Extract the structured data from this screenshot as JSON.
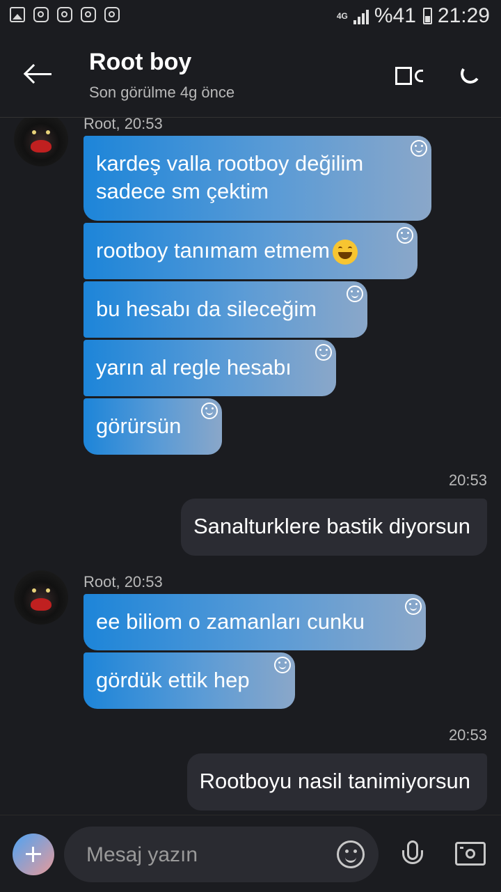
{
  "status_bar": {
    "battery": "%41",
    "time": "21:29",
    "network": "4G"
  },
  "header": {
    "title": "Root boy",
    "subtitle": "Son görülme 4g önce"
  },
  "messages": {
    "group1": {
      "sender": "Root, 20:53",
      "bubbles": [
        "kardeş valla rootboy değilim sadece sm  çektim",
        "rootboy tanımam etmem",
        "bu hesabı da sileceğim",
        "yarın al regle hesabı",
        "görürsün"
      ]
    },
    "out1": {
      "time": "20:53",
      "text": "Sanalturklere bastik diyorsun"
    },
    "group2": {
      "sender": "Root, 20:53",
      "bubbles": [
        "ee biliom o zamanları  cunku",
        "gördük ettik hep"
      ]
    },
    "out2": {
      "time": "20:53",
      "text": "Rootboyu nasil tanimiyorsun"
    }
  },
  "input": {
    "placeholder": "Mesaj yazın"
  },
  "colors": {
    "background": "#1b1c20",
    "incoming_start": "#1d85d9",
    "incoming_end": "#8aa7c9",
    "outgoing": "#2b2c33"
  }
}
